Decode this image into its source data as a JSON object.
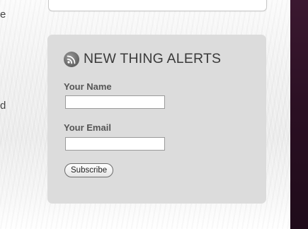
{
  "page": {
    "left_fragments": [
      "e",
      "d"
    ]
  },
  "widget": {
    "title": "NEW THING ALERTS",
    "icon": "rss-feed-icon",
    "name_label": "Your Name",
    "name_value": "",
    "email_label": "Your Email",
    "email_value": "",
    "subscribe_label": "Subscribe"
  },
  "colors": {
    "widget_bg": "#dcdcdc",
    "title_text": "#3a3a3a",
    "label_text": "#555555",
    "sidebar_strip": "#2a0f22"
  }
}
